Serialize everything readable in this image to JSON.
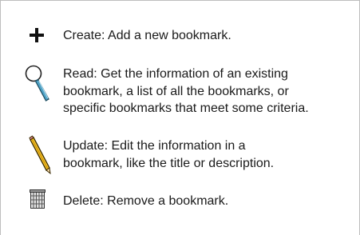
{
  "operations": [
    {
      "icon": "plus-icon",
      "lines": [
        "Create: Add a new bookmark."
      ]
    },
    {
      "icon": "magnifier-icon",
      "lines": [
        "Read: Get the information of an existing",
        "bookmark, a list of all the bookmarks, or",
        "specific bookmarks that meet some criteria."
      ]
    },
    {
      "icon": "pencil-icon",
      "lines": [
        "Update: Edit the information in a",
        "bookmark, like the title or description."
      ]
    },
    {
      "icon": "trash-icon",
      "lines": [
        "Delete: Remove a bookmark."
      ]
    }
  ]
}
